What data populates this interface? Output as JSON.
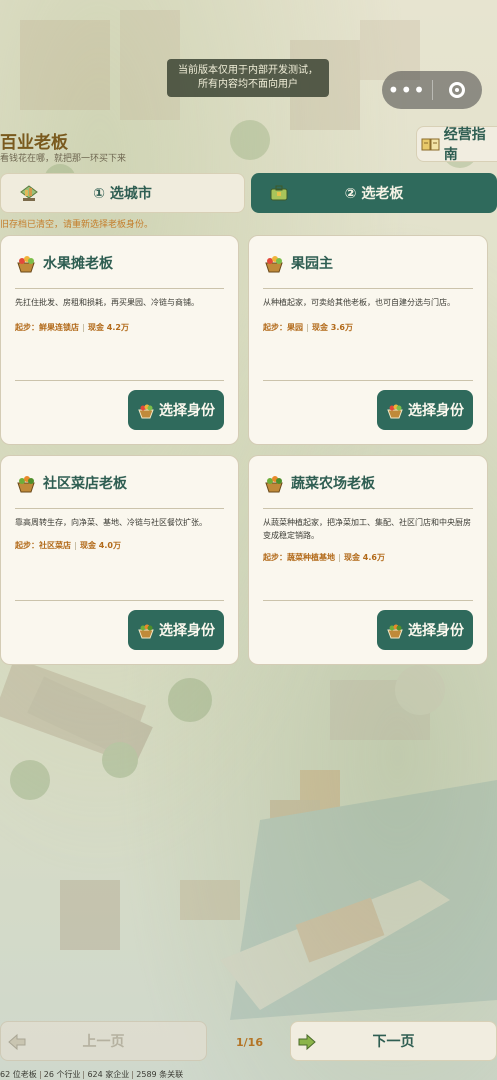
{
  "notice": {
    "line1": "当前版本仅用于内部开发测试，",
    "line2": "所有内容均不面向用户"
  },
  "app": {
    "title": "百业老板",
    "subtitle": "看钱花在哪，就把那一环买下来"
  },
  "guide_button": {
    "label": "经营指南",
    "icon": "book-icon"
  },
  "tabs": [
    {
      "label": "① 选城市",
      "icon": "city-icon",
      "active": false
    },
    {
      "label": "② 选老板",
      "icon": "briefcase-icon",
      "active": true
    }
  ],
  "hint": "旧存档已清空，请重新选择老板身份。",
  "cards": [
    {
      "title": "水果摊老板",
      "desc": "先扛住批发、房租和损耗，再买果园、冷链与商铺。",
      "start_label": "起步：鲜果连锁店",
      "cash": "现金 4.2万",
      "button": "选择身份"
    },
    {
      "title": "果园主",
      "desc": "从种植起家，可卖给其他老板，也可自建分选与门店。",
      "start_label": "起步：果园",
      "cash": "现金 3.6万",
      "button": "选择身份"
    },
    {
      "title": "社区菜店老板",
      "desc": "靠高周转生存，向净菜、基地、冷链与社区餐饮扩张。",
      "start_label": "起步：社区菜店",
      "cash": "现金 4.0万",
      "button": "选择身份"
    },
    {
      "title": "蔬菜农场老板",
      "desc": "从蔬菜种植起家，把净菜加工、集配、社区门店和中央厨房变成稳定销路。",
      "start_label": "起步：蔬菜种植基地",
      "cash": "现金 4.6万",
      "button": "选择身份"
    }
  ],
  "pager": {
    "prev_label": "上一页",
    "next_label": "下一页",
    "page_text": "1/16"
  },
  "stats": [
    "62 位老板",
    "26 个行业",
    "624 家企业",
    "2589 条关联"
  ],
  "colors": {
    "accent": "#2f6a5c",
    "gold": "#b26a1a",
    "title": "#7a5a1e"
  }
}
